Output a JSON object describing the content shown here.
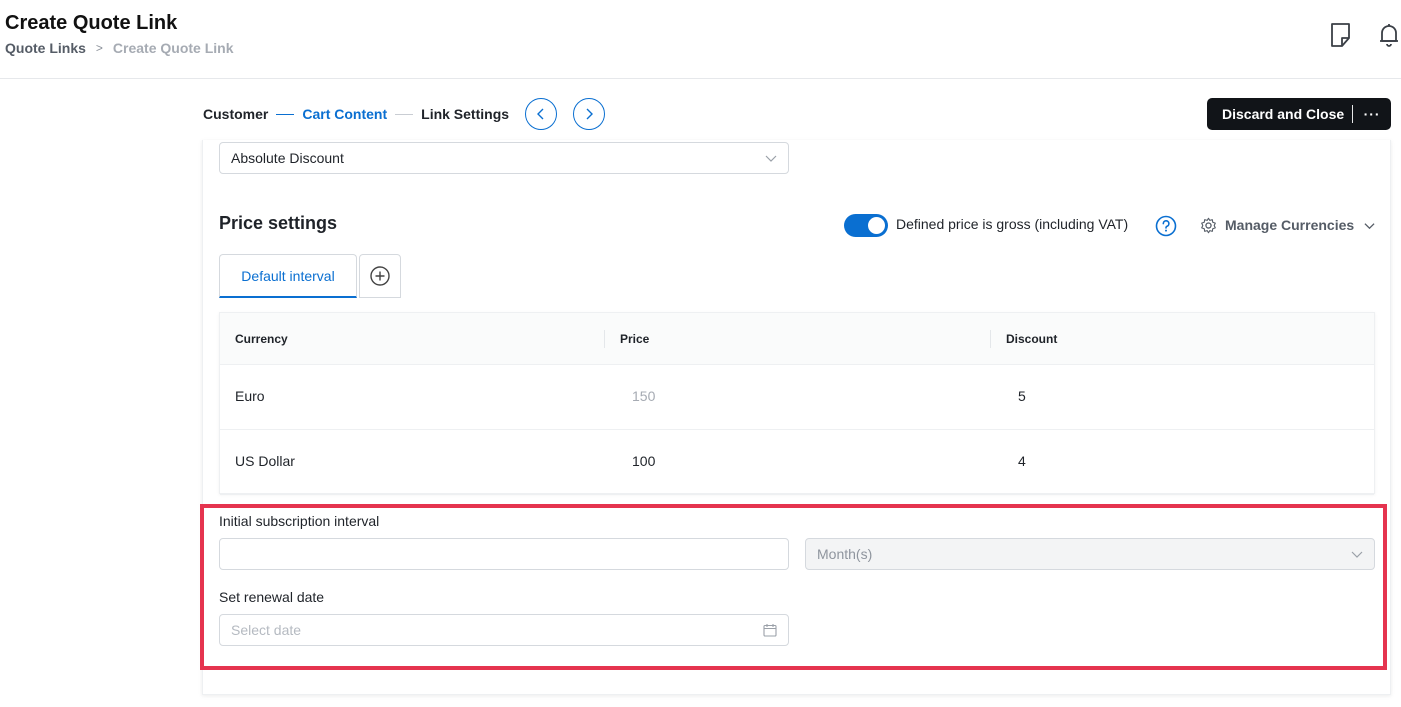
{
  "header": {
    "title": "Create Quote Link",
    "breadcrumb": {
      "parent": "Quote Links",
      "separator": ">",
      "current": "Create Quote Link"
    },
    "icons": [
      "note-icon",
      "bell-icon"
    ]
  },
  "stepper": {
    "steps": [
      "Customer",
      "Cart Content",
      "Link Settings"
    ],
    "active_step": "Cart Content"
  },
  "actions": {
    "discard_label": "Discard and Close",
    "more_label": "···"
  },
  "discount_type": {
    "value": "Absolute Discount"
  },
  "price_settings": {
    "title": "Price settings",
    "gross_toggle": {
      "label": "Defined price is gross (including VAT)",
      "on": true
    },
    "manage_currencies": "Manage Currencies",
    "tabs": [
      "Default interval"
    ],
    "table": {
      "columns": [
        "Currency",
        "Price",
        "Discount"
      ],
      "rows": [
        {
          "currency": "Euro",
          "price": "150",
          "discount": "5"
        },
        {
          "currency": "US Dollar",
          "price": "100",
          "discount": "4"
        }
      ]
    }
  },
  "subscription": {
    "interval_label": "Initial subscription interval",
    "interval_value": "",
    "interval_unit": "Month(s)",
    "renewal_label": "Set renewal date",
    "renewal_placeholder": "Select date"
  },
  "colors": {
    "accent": "#0a6fd1",
    "highlight": "#e5344f",
    "dark_button": "#111418"
  }
}
